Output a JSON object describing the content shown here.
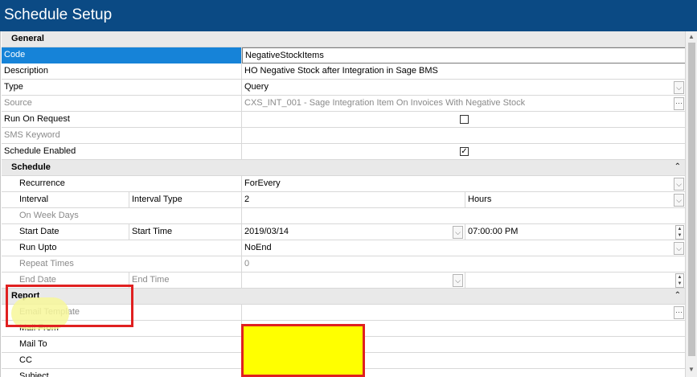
{
  "window": {
    "title": "Schedule Setup"
  },
  "colors": {
    "titlebar": "#0b4a84",
    "selection": "#1683d8",
    "annotation_red": "#e02020",
    "annotation_yellow": "#ffff00"
  },
  "general": {
    "header": "General",
    "code": {
      "label": "Code",
      "value": "NegativeStockItems"
    },
    "description": {
      "label": "Description",
      "value": "HO Negative Stock after Integration in Sage BMS"
    },
    "type": {
      "label": "Type",
      "value": "Query"
    },
    "source": {
      "label": "Source",
      "value": "CXS_INT_001 - Sage Integration Item On Invoices With Negative Stock"
    },
    "run_on_request": {
      "label": "Run On Request",
      "checked": false
    },
    "sms_keyword": {
      "label": "SMS Keyword",
      "value": ""
    },
    "schedule_enabled": {
      "label": "Schedule Enabled",
      "checked": true
    }
  },
  "schedule": {
    "header": "Schedule",
    "recurrence": {
      "label": "Recurrence",
      "value": "ForEvery"
    },
    "interval": {
      "label": "Interval",
      "type_label": "Interval Type",
      "value": "2",
      "unit": "Hours"
    },
    "on_week_days": {
      "label": "On Week Days"
    },
    "start": {
      "label": "Start Date",
      "time_label": "Start Time",
      "date": "2019/03/14",
      "time": "07:00:00 PM"
    },
    "run_upto": {
      "label": "Run Upto",
      "value": "NoEnd"
    },
    "repeat_times": {
      "label": "Repeat Times",
      "value": "0"
    },
    "end": {
      "label": "End Date",
      "time_label": "End Time"
    }
  },
  "report": {
    "header": "Report",
    "email_template": {
      "label": "Email Template"
    },
    "mail_from": {
      "label": "Mail From"
    },
    "mail_to": {
      "label": "Mail To"
    },
    "cc": {
      "label": "CC"
    },
    "subject": {
      "label": "Subject"
    }
  },
  "icons": {
    "dropdown": "⌵",
    "ellipsis": "···",
    "collapse": "⌃",
    "check": "✓",
    "spin_up": "▲",
    "spin_down": "▼"
  }
}
